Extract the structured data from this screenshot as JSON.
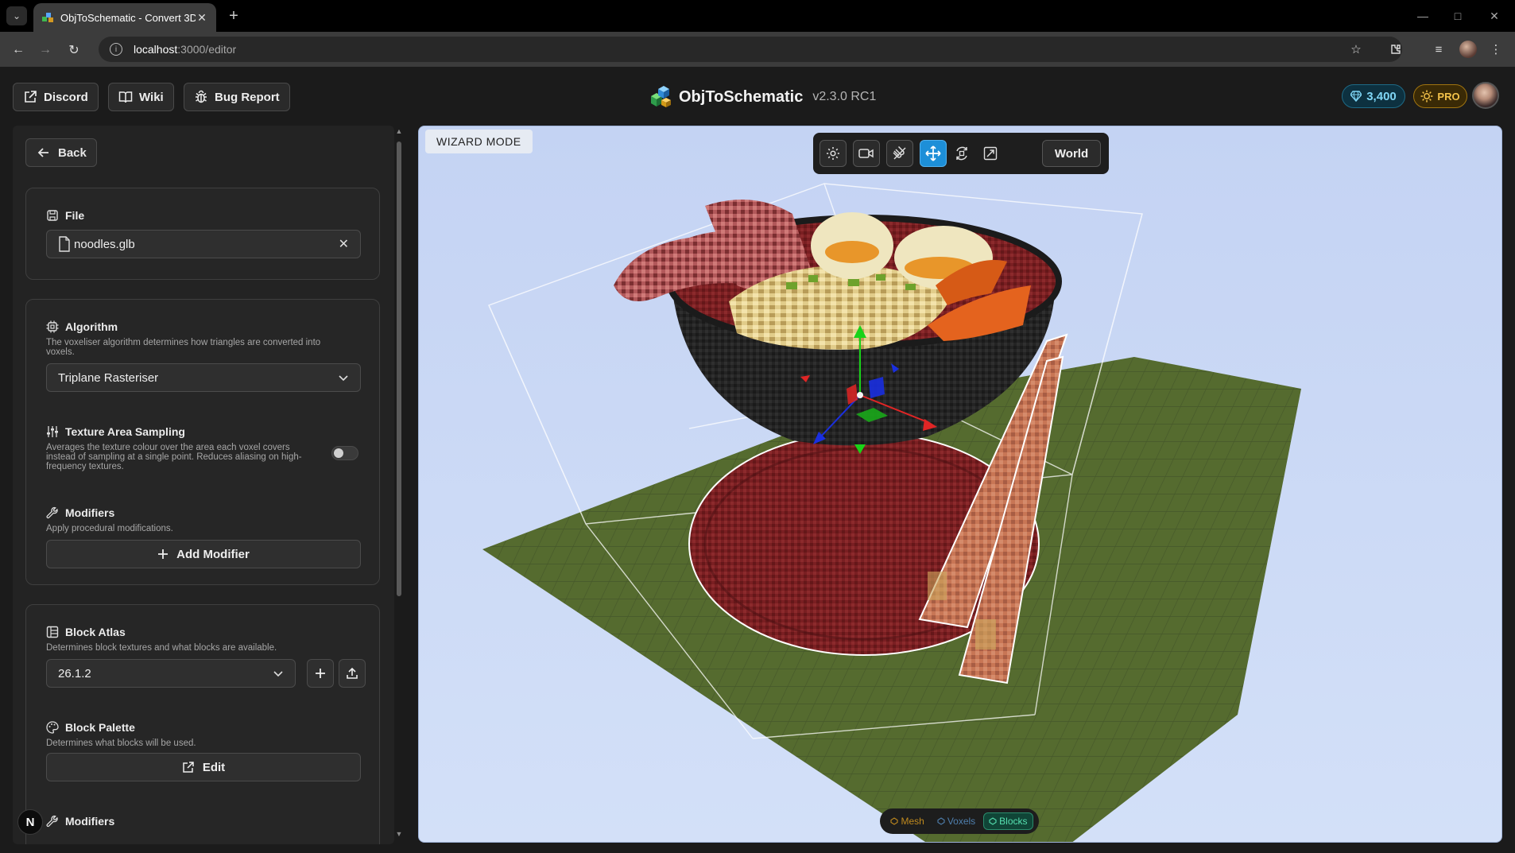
{
  "browser": {
    "tab_title": "ObjToSchematic - Convert 3D m",
    "url_host": "localhost",
    "url_path": ":3000/editor",
    "icons": [
      "tab-list-icon",
      "close-icon",
      "plus-icon",
      "minimize-icon",
      "maximize-icon",
      "close-window-icon",
      "back-arrow-icon",
      "forward-arrow-icon",
      "reload-icon",
      "info-icon",
      "star-icon",
      "extensions-icon",
      "media-icon",
      "profile-icon",
      "kebab-menu-icon"
    ]
  },
  "header": {
    "discord_label": "Discord",
    "wiki_label": "Wiki",
    "bug_report_label": "Bug Report",
    "app_name": "ObjToSchematic",
    "version": "v2.3.0 RC1",
    "gems": "3,400",
    "pro_label": "PRO"
  },
  "sidebar": {
    "back_label": "Back",
    "file": {
      "title": "File",
      "filename": "noodles.glb"
    },
    "algorithm": {
      "title": "Algorithm",
      "description": "The voxeliser algorithm determines how triangles are converted into voxels.",
      "selected": "Triplane Rasteriser"
    },
    "texture_sampling": {
      "title": "Texture Area Sampling",
      "description": "Averages the texture colour over the area each voxel covers instead of sampling at a single point. Reduces aliasing on high-frequency textures.",
      "enabled": false
    },
    "modifiers": {
      "title": "Modifiers",
      "description": "Apply procedural modifications.",
      "add_label": "Add Modifier"
    },
    "block_atlas": {
      "title": "Block Atlas",
      "description": "Determines block textures and what blocks are available.",
      "selected": "26.1.2"
    },
    "block_palette": {
      "title": "Block Palette",
      "description": "Determines what blocks will be used.",
      "edit_label": "Edit"
    },
    "modifiers2": {
      "title": "Modifiers"
    },
    "badge": "N"
  },
  "viewport": {
    "wizard_label": "WIZARD MODE",
    "space_label": "World",
    "active_tool": "move",
    "modes": [
      {
        "label": "Mesh",
        "active": false
      },
      {
        "label": "Voxels",
        "active": false
      },
      {
        "label": "Blocks",
        "active": true
      }
    ],
    "colors": {
      "background": "#c8d7f5",
      "grass": "#556b2f",
      "bowl": "#262626",
      "broth": "#6e1d1d",
      "chopsticks": "#c97a5a",
      "gizmo_x": "#e02525",
      "gizmo_y": "#19d219",
      "gizmo_z": "#1a2fe0"
    }
  }
}
